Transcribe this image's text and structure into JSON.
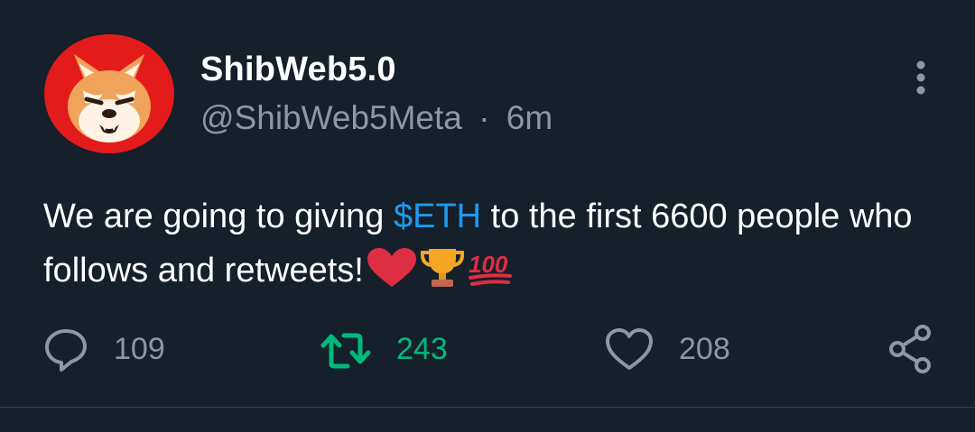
{
  "author": {
    "display_name": "ShibWeb5.0",
    "handle": "@ShibWeb5Meta",
    "separator": "·",
    "time": "6m",
    "avatar_icon": "shiba-inu-avatar-icon"
  },
  "tweet": {
    "text_before": "We are going to giving ",
    "cashtag": "$ETH",
    "text_after": " to the first 6600 people who follows and retweets!",
    "emojis": [
      "heart-icon",
      "trophy-icon",
      "hundred-points-icon"
    ]
  },
  "actions": {
    "reply_count": "109",
    "retweet_count": "243",
    "like_count": "208"
  },
  "colors": {
    "background": "#15202b",
    "muted": "#8b98a5",
    "link": "#1d9bf0",
    "retweet_active": "#00ba7c"
  }
}
